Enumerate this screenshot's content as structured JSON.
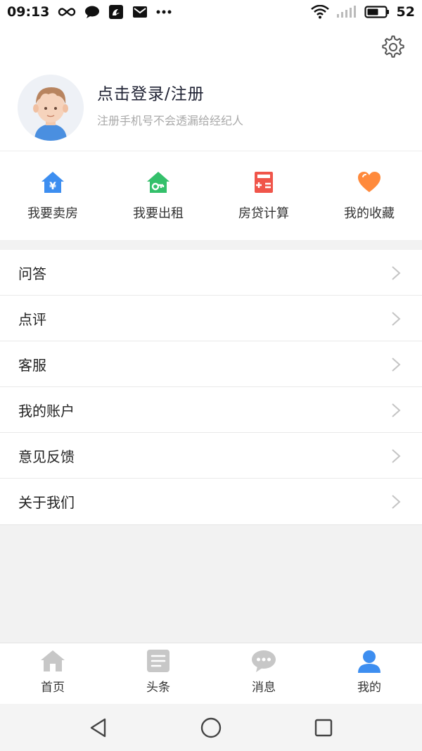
{
  "status_bar": {
    "time": "09:13",
    "battery": "52",
    "left_icons": [
      "infinity-icon",
      "chat-bubble-icon",
      "uc-browser-icon",
      "mail-icon",
      "more-dots-icon"
    ],
    "right_icons": [
      "wifi-icon",
      "signal-icon",
      "battery-icon"
    ]
  },
  "profile": {
    "login_title": "点击登录/注册",
    "login_subtitle": "注册手机号不会透漏给经纪人"
  },
  "quick_actions": [
    {
      "label": "我要卖房",
      "icon": "house-yen-icon",
      "color": "#3d8ef0"
    },
    {
      "label": "我要出租",
      "icon": "house-key-icon",
      "color": "#34c06b"
    },
    {
      "label": "房贷计算",
      "icon": "calculator-icon",
      "color": "#f0554a"
    },
    {
      "label": "我的收藏",
      "icon": "heart-icon",
      "color": "#ff8a3c"
    }
  ],
  "menu": [
    {
      "label": "问答"
    },
    {
      "label": "点评"
    },
    {
      "label": "客服"
    },
    {
      "label": "我的账户"
    },
    {
      "label": "意见反馈"
    },
    {
      "label": "关于我们"
    }
  ],
  "tabbar": [
    {
      "label": "首页",
      "icon": "home-icon",
      "active": false
    },
    {
      "label": "头条",
      "icon": "news-icon",
      "active": false
    },
    {
      "label": "消息",
      "icon": "message-icon",
      "active": false
    },
    {
      "label": "我的",
      "icon": "user-icon",
      "active": true
    }
  ],
  "colors": {
    "accent": "#3d8ef0",
    "inactive_icon": "#c7c7c7"
  }
}
